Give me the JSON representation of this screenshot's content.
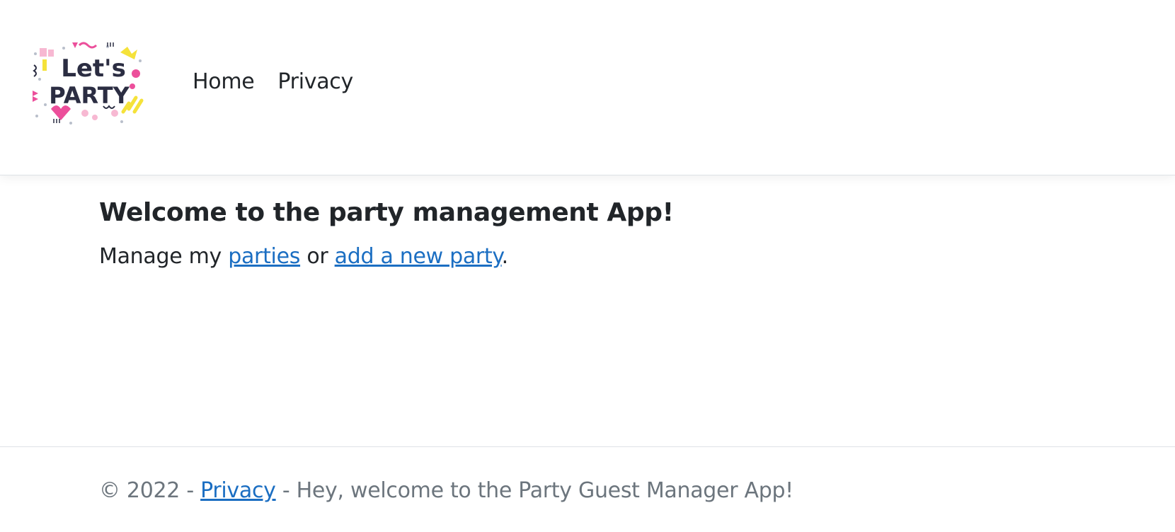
{
  "header": {
    "logo": {
      "text_line1": "Let's",
      "text_line2": "PARTY",
      "colors": {
        "ink": "#2b2d42",
        "pink": "#ec4f9b",
        "yellow": "#f5e23a",
        "lightpink": "#f7b8d2",
        "gray": "#b9bfcb"
      }
    },
    "nav": [
      {
        "label": "Home"
      },
      {
        "label": "Privacy"
      }
    ]
  },
  "main": {
    "title": "Welcome to the party management App!",
    "intro_prefix": "Manage my ",
    "parties_link": "parties",
    "intro_middle": " or ",
    "add_party_link": "add a new party",
    "intro_suffix": "."
  },
  "footer": {
    "copyright": "© 2022 - ",
    "privacy_link": "Privacy",
    "message": " - Hey, welcome to the Party Guest Manager App!"
  },
  "colors": {
    "link": "#1b6ec2",
    "text": "#212529",
    "muted": "#6c757d",
    "border": "#dee2e6"
  }
}
